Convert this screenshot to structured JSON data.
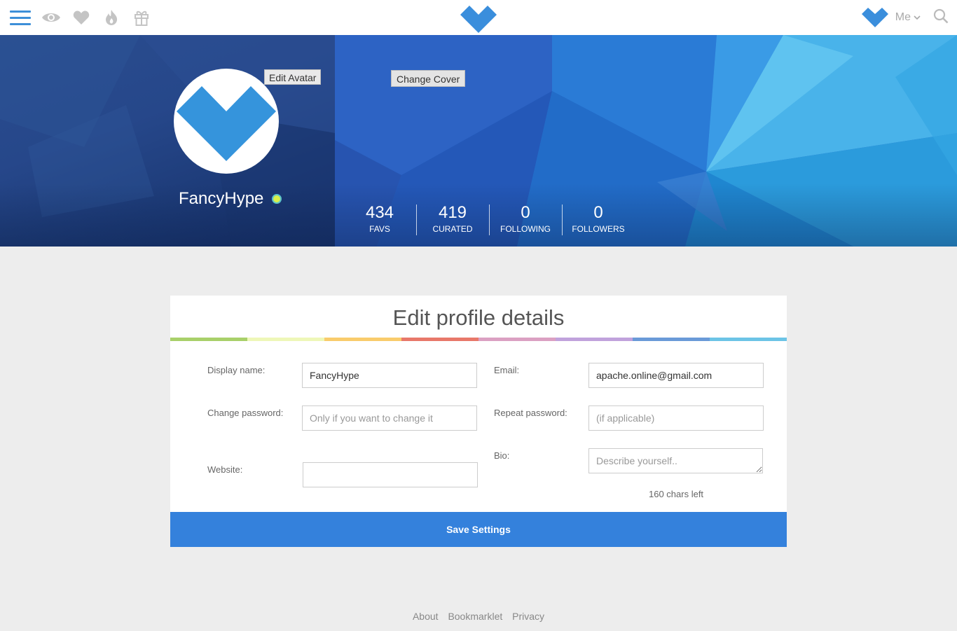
{
  "topbar": {
    "icons": [
      "menu-icon",
      "eye-icon",
      "heart-icon",
      "flame-icon",
      "gift-icon"
    ],
    "me_label": "Me",
    "brand_color": "#3d8fd8"
  },
  "profile": {
    "edit_avatar_label": "Edit Avatar",
    "change_cover_label": "Change Cover",
    "username": "FancyHype",
    "status": "online",
    "stats": [
      {
        "value": "434",
        "label": "FAVS"
      },
      {
        "value": "419",
        "label": "CURATED"
      },
      {
        "value": "0",
        "label": "FOLLOWING"
      },
      {
        "value": "0",
        "label": "FOLLOWERS"
      }
    ]
  },
  "form": {
    "title": "Edit profile details",
    "rainbow_colors": [
      "#a8d06a",
      "#eef7b8",
      "#f9cc6c",
      "#e8786a",
      "#dba0c2",
      "#c0a2dc",
      "#6a9ad8",
      "#6cc4e6"
    ],
    "display_name_label": "Display name:",
    "display_name_value": "FancyHype",
    "email_label": "Email:",
    "email_value": "apache.online@gmail.com",
    "change_password_label": "Change password:",
    "change_password_placeholder": "Only if you want to change it",
    "repeat_password_label": "Repeat password:",
    "repeat_password_placeholder": "(if applicable)",
    "website_label": "Website:",
    "website_value": "",
    "bio_label": "Bio:",
    "bio_placeholder": "Describe yourself..",
    "chars_left": "160 chars left",
    "save_label": "Save Settings"
  },
  "footer": {
    "links": [
      "About",
      "Bookmarklet",
      "Privacy"
    ]
  }
}
